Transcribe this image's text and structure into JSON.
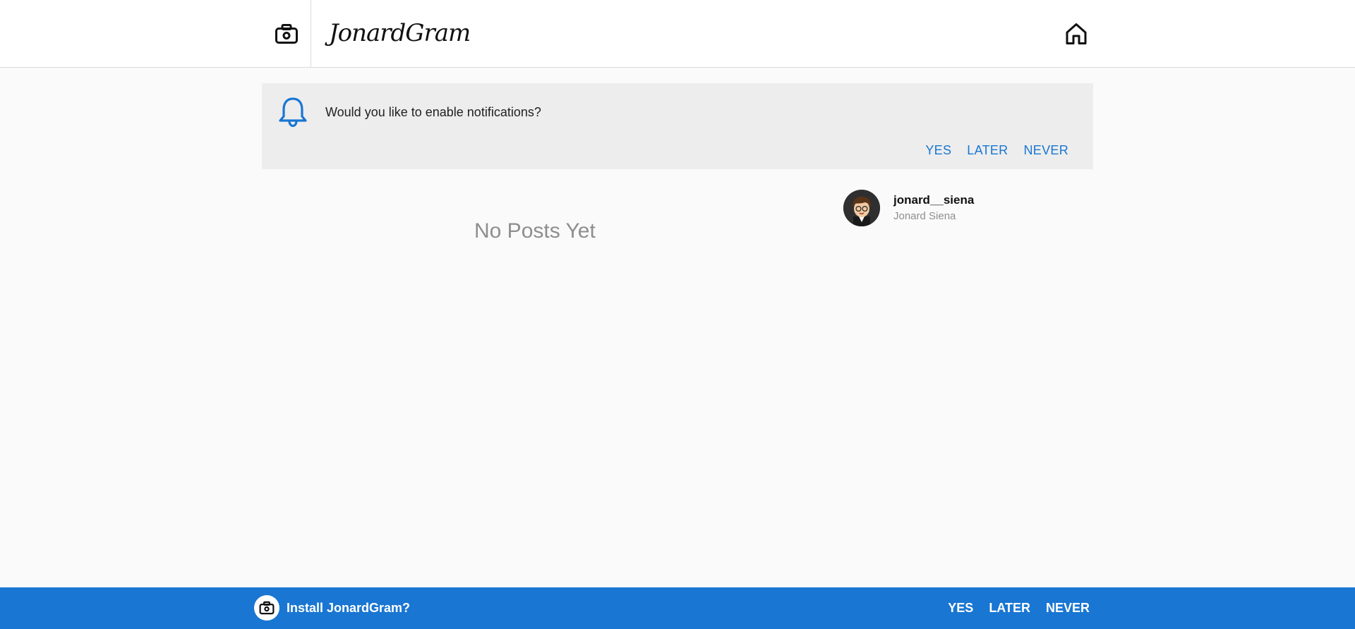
{
  "header": {
    "brand": "JonardGram",
    "camera_icon": "camera-icon",
    "home_icon": "home-icon"
  },
  "notification_prompt": {
    "icon": "bell-icon",
    "message": "Would you like to enable notifications?",
    "yes_label": "YES",
    "later_label": "LATER",
    "never_label": "NEVER"
  },
  "feed": {
    "empty_message": "No Posts Yet"
  },
  "profile": {
    "username": "jonard__siena",
    "full_name": "Jonard Siena",
    "avatar_icon": "user-avatar"
  },
  "install_prompt": {
    "icon": "camera-icon",
    "message": "Install JonardGram?",
    "yes_label": "YES",
    "later_label": "LATER",
    "never_label": "NEVER"
  },
  "colors": {
    "accent": "#1976d2",
    "background": "#fafafa",
    "banner": "#ededed",
    "muted_text": "#8e8e8e"
  }
}
